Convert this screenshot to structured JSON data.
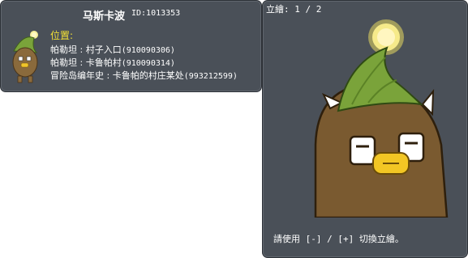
{
  "npc": {
    "name": "马斯卡波",
    "id_text": "ID:1013353"
  },
  "location": {
    "label": "位置:",
    "entries": [
      {
        "text": "帕勒坦 : 村子入口",
        "code": "(910090306)"
      },
      {
        "text": "帕勒坦 : 卡鲁帕村",
        "code": "(910090314)"
      },
      {
        "text": "冒险岛编年史 : 卡鲁帕的村庄某处",
        "code": "(993212599)"
      }
    ]
  },
  "illustration": {
    "page_indicator": "立繪: 1 / 2",
    "hint": "請使用 [-] / [+] 切換立繪。"
  },
  "colors": {
    "panel_bg": "#4a5058",
    "label_yellow": "#f2e035",
    "text": "#ffffff"
  }
}
